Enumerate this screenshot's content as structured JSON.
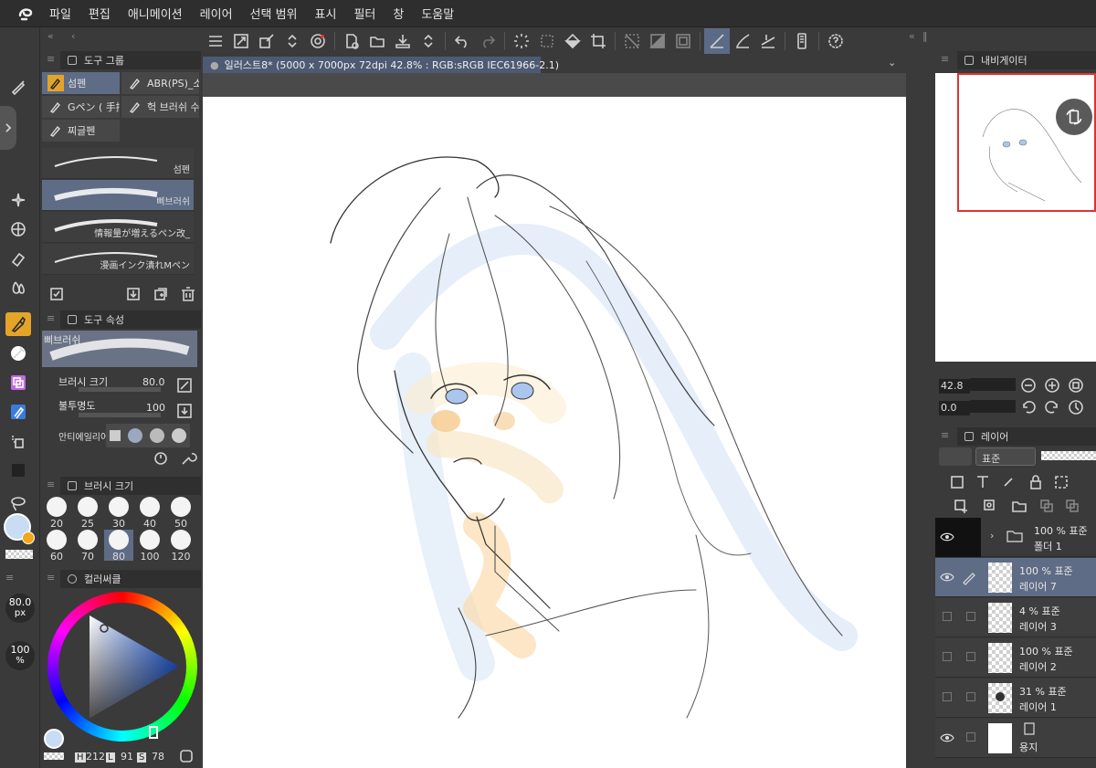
{
  "menu": {
    "items": [
      "파일",
      "편집",
      "애니메이션",
      "레이어",
      "선택 범위",
      "표시",
      "필터",
      "창",
      "도움말"
    ]
  },
  "colors": {
    "accent": "#5e6c86",
    "active_tool": "#e4a428",
    "nav_frame": "#dd3333"
  },
  "subtool_panel": {
    "title": "도구 그룹",
    "items": [
      {
        "label": "섬펜",
        "active": true
      },
      {
        "label": "ABR(PS)_소",
        "active": false
      },
      {
        "label": "Gペン ( 手描",
        "active": false
      },
      {
        "label": "헉 브러쉬 수",
        "active": false
      },
      {
        "label": "찌글펜",
        "active": false
      }
    ],
    "brushes": [
      {
        "label": "섬펜",
        "active": false
      },
      {
        "label": "삐브러쉬",
        "active": true
      },
      {
        "label": "情報量が増えるペン改_",
        "active": false
      },
      {
        "label": "漫画インク潰れMペン",
        "active": false
      }
    ]
  },
  "tool_property": {
    "title": "도구 속성",
    "brush_name": "삐브러쉬",
    "brush_size_label": "브러시 크기",
    "brush_size_value": "80.0",
    "opacity_label": "불투명도",
    "opacity_value": "100",
    "antialias_label": "안티에일리어"
  },
  "brush_size_panel": {
    "title": "브러시 크기",
    "sizes": [
      "20",
      "25",
      "30",
      "40",
      "50",
      "60",
      "70",
      "80",
      "100",
      "120"
    ],
    "active": "80"
  },
  "color_panel": {
    "title": "컬러써클",
    "h_label": "H",
    "h_value": "212",
    "s_label": "L",
    "s_value": "91",
    "v_label": "S",
    "v_value": "78"
  },
  "left_strip": {
    "size_value": "80.0",
    "size_unit": "px",
    "opacity_value": "100",
    "opacity_unit": "%"
  },
  "canvas": {
    "tab_title": "일러스트8* (5000 x 7000px 72dpi 42.8% : RGB:sRGB IEC61966-2.1)"
  },
  "navigator": {
    "title": "내비게이터",
    "zoom": "42.8",
    "rotation": "0.0"
  },
  "layers": {
    "title": "레이어",
    "blend_mode": "표준",
    "items": [
      {
        "mode": "100 % 표준",
        "name": "폴더 1",
        "type": "folder",
        "visible": true,
        "active": false
      },
      {
        "mode": "100 % 표준",
        "name": "레이어 7",
        "type": "raster",
        "visible": true,
        "active": true
      },
      {
        "mode": "4 % 표준",
        "name": "레이어 3",
        "type": "raster",
        "visible": false,
        "active": false
      },
      {
        "mode": "100 % 표준",
        "name": "레이어 2",
        "type": "raster",
        "visible": false,
        "active": false
      },
      {
        "mode": "31 % 표준",
        "name": "레이어 1",
        "type": "raster",
        "visible": false,
        "active": false
      },
      {
        "mode": "",
        "name": "용지",
        "type": "paper",
        "visible": true,
        "active": false
      }
    ]
  }
}
